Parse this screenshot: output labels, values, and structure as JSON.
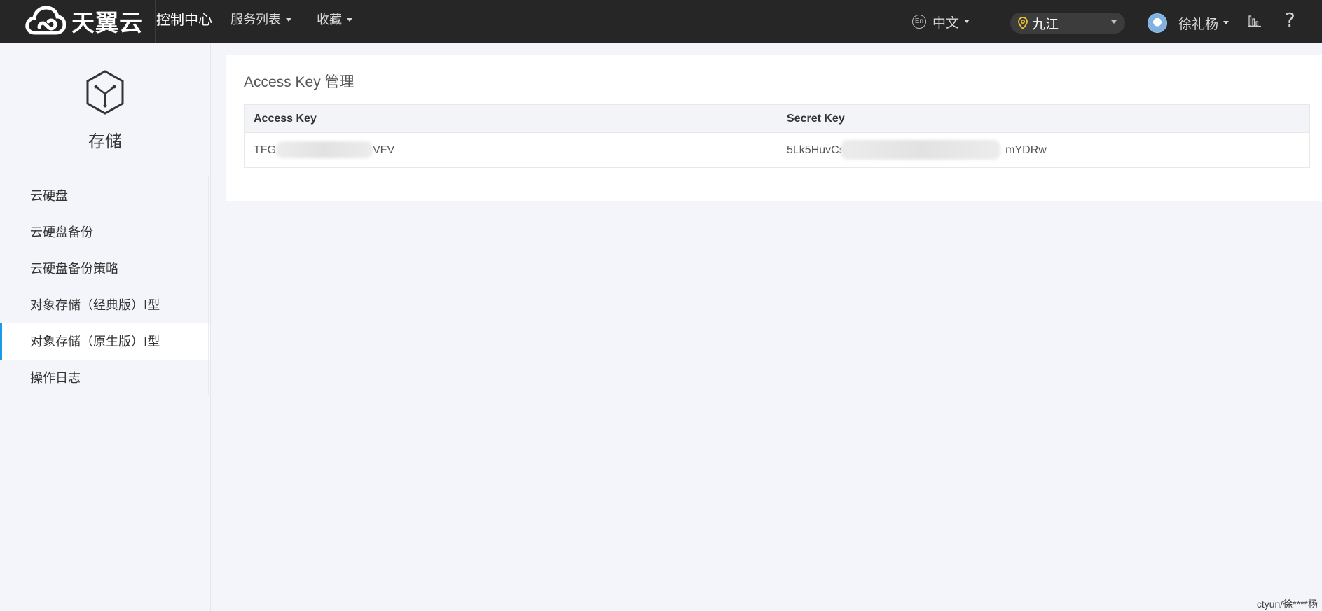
{
  "topbar": {
    "logo_text": "天翼云",
    "console_title": "控制中心",
    "nav": [
      {
        "label": "服务列表"
      },
      {
        "label": "收藏"
      }
    ],
    "language": {
      "icon_text": "En",
      "label": "中文"
    },
    "region": {
      "label": "九江"
    },
    "user": {
      "name": "徐礼杨"
    }
  },
  "sidebar": {
    "title": "存储",
    "items": [
      {
        "label": "云硬盘",
        "active": false
      },
      {
        "label": "云硬盘备份",
        "active": false
      },
      {
        "label": "云硬盘备份策略",
        "active": false
      },
      {
        "label": "对象存储（经典版）Ⅰ型",
        "active": false
      },
      {
        "label": "对象存储（原生版）Ⅰ型",
        "active": true
      },
      {
        "label": "操作日志",
        "active": false
      }
    ]
  },
  "main": {
    "title": "Access Key 管理",
    "table": {
      "headers": [
        "Access Key",
        "Secret Key"
      ],
      "rows": [
        {
          "access_key_prefix": "TFG",
          "access_key_suffix": "VFV",
          "secret_key_prefix": "5Lk5HuvCsI",
          "secret_key_suffix": "mYDRw"
        }
      ]
    }
  },
  "footer": {
    "user_label": "ctyun/徐****杨"
  },
  "colors": {
    "topbar": "#262626",
    "accent": "#1a9be6",
    "background": "#f3f5fa"
  }
}
